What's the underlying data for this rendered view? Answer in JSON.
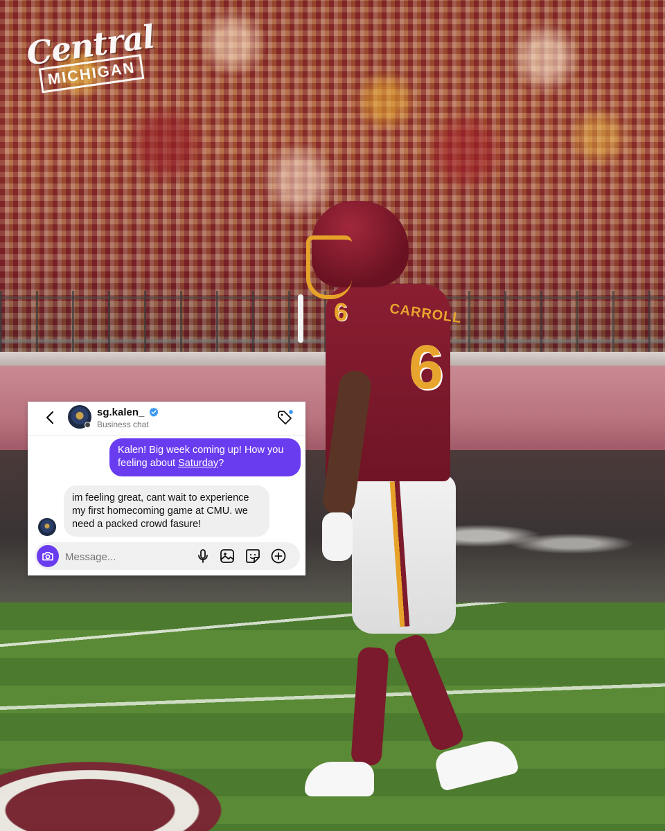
{
  "brand": {
    "line1": "Central",
    "line2": "MICHIGAN"
  },
  "jersey": {
    "number": "6",
    "name": "CARROLL"
  },
  "chat": {
    "header": {
      "username": "sg.kalen_",
      "subtitle": "Business chat",
      "icons": [
        "back-icon",
        "verified-badge-icon",
        "tag-icon"
      ]
    },
    "messages": [
      {
        "direction": "outgoing",
        "text_before": "Kalen! Big week coming up! How you feeling about ",
        "link": "Saturday",
        "text_after": "?"
      },
      {
        "direction": "incoming",
        "text": "im feeling great, cant wait to experience my first homecoming game at CMU. we need a packed crowd fasure!"
      }
    ],
    "composer": {
      "placeholder": "Message...",
      "icons": [
        "camera-icon",
        "microphone-icon",
        "gallery-icon",
        "sticker-icon",
        "plus-icon"
      ]
    },
    "colors": {
      "accent": "#6a3cf0",
      "incoming_bubble": "#efefef"
    }
  }
}
